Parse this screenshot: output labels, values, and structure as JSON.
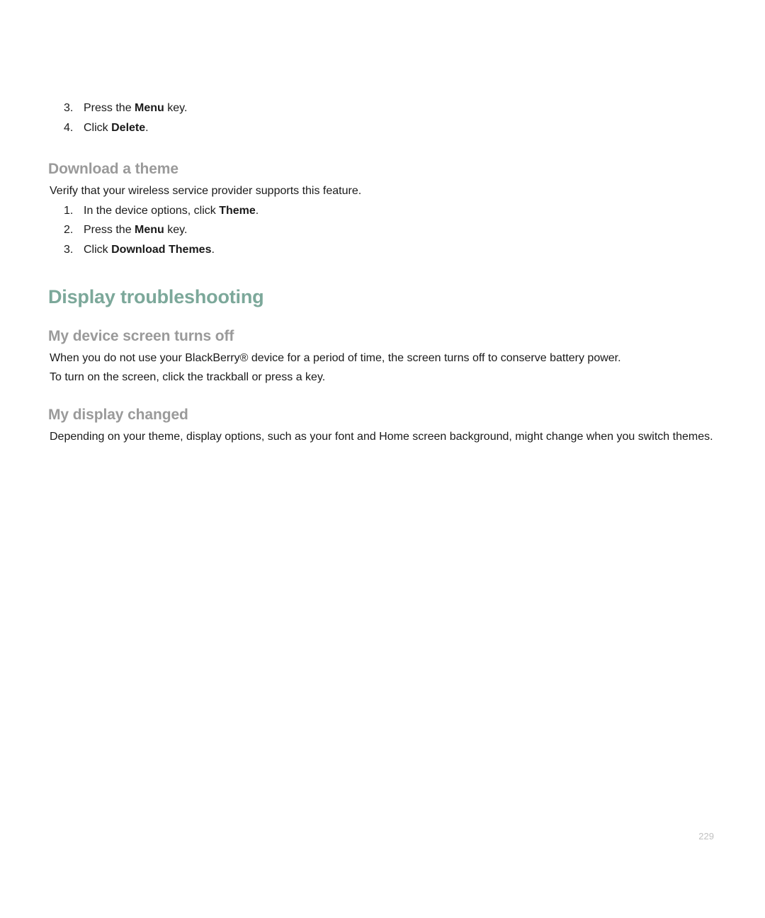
{
  "topList": {
    "items": [
      {
        "num": "3.",
        "pre": "Press the ",
        "bold": "Menu",
        "post": " key."
      },
      {
        "num": "4.",
        "pre": "Click ",
        "bold": "Delete",
        "post": "."
      }
    ]
  },
  "downloadTheme": {
    "heading": "Download a theme",
    "intro": "Verify that your wireless service provider supports this feature.",
    "items": [
      {
        "num": "1.",
        "pre": "In the device options, click ",
        "bold": "Theme",
        "post": "."
      },
      {
        "num": "2.",
        "pre": "Press the ",
        "bold": "Menu",
        "post": " key."
      },
      {
        "num": "3.",
        "pre": "Click ",
        "bold": "Download Themes",
        "post": "."
      }
    ]
  },
  "displayTroubleshooting": {
    "heading": "Display troubleshooting"
  },
  "screenTurnsOff": {
    "heading": "My device screen turns off",
    "para1": "When you do not use your BlackBerry® device for a period of time, the screen turns off to conserve battery power.",
    "para2": "To turn on the screen, click the trackball or press a key."
  },
  "displayChanged": {
    "heading": "My display changed",
    "para1": "Depending on your theme, display options, such as your font and Home screen background, might change when you switch themes."
  },
  "pageNumber": "229"
}
